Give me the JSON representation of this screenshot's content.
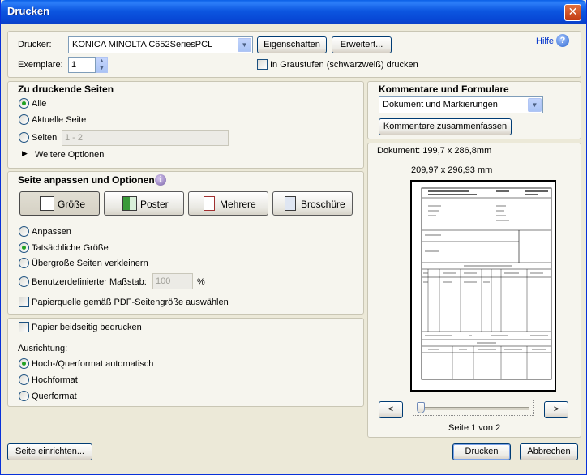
{
  "window": {
    "title": "Drucken"
  },
  "printer": {
    "label": "Drucker:",
    "selected": "KONICA MINOLTA C652SeriesPCL",
    "properties_button": "Eigenschaften",
    "advanced_button": "Erweitert...",
    "help_link": "Hilfe",
    "copies_label": "Exemplare:",
    "copies_value": "1",
    "grayscale_label": "In Graustufen (schwarzweiß) drucken"
  },
  "pages": {
    "heading": "Zu druckende Seiten",
    "all": "Alle",
    "current": "Aktuelle Seite",
    "pages_label": "Seiten",
    "pages_value": "1 - 2",
    "more_options": "Weitere Optionen"
  },
  "fit": {
    "heading": "Seite anpassen und Optionen",
    "tabs": {
      "size": "Größe",
      "poster": "Poster",
      "multiple": "Mehrere",
      "booklet": "Broschüre"
    },
    "fit_option": "Anpassen",
    "actual_size": "Tatsächliche Größe",
    "shrink": "Übergroße Seiten verkleinern",
    "custom_scale": "Benutzerdefinierter Maßstab:",
    "scale_value": "100",
    "percent": "%",
    "paper_source": "Papierquelle gemäß PDF-Seitengröße auswählen"
  },
  "duplex": {
    "both_sides": "Papier beidseitig bedrucken",
    "orientation_label": "Ausrichtung:",
    "auto": "Hoch-/Querformat automatisch",
    "portrait": "Hochformat",
    "landscape": "Querformat"
  },
  "comments": {
    "heading": "Kommentare und Formulare",
    "selected": "Dokument und Markierungen",
    "summarize_button": "Kommentare zusammenfassen"
  },
  "preview": {
    "document_size": "Dokument: 199,7 x 286,8mm",
    "page_size": "209,97 x 296,93 mm",
    "prev": "<",
    "next": ">",
    "page_indicator": "Seite 1 von 2"
  },
  "footer": {
    "page_setup": "Seite einrichten...",
    "print": "Drucken",
    "cancel": "Abbrechen"
  }
}
